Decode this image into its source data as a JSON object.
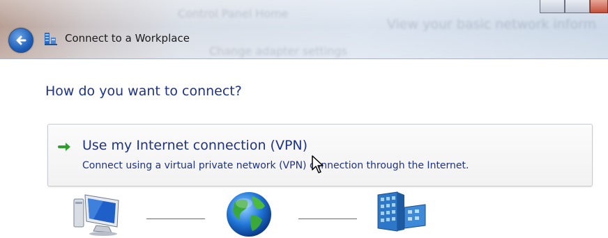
{
  "window": {
    "title": "Connect to a Workplace",
    "background_blur_text": [
      "Control Panel Home",
      "View your basic network inform",
      "Change adapter settings"
    ]
  },
  "page": {
    "heading": "How do you want to connect?"
  },
  "options": [
    {
      "title": "Use my Internet connection (VPN)",
      "description": "Connect using a virtual private network (VPN) connection through the Internet."
    }
  ],
  "diagram": {
    "icons": [
      "computer-icon",
      "globe-icon",
      "building-icon"
    ]
  },
  "colors": {
    "heading": "#1e3287",
    "arrow": "#2ea02e",
    "option_border": "#c8ccd2"
  }
}
